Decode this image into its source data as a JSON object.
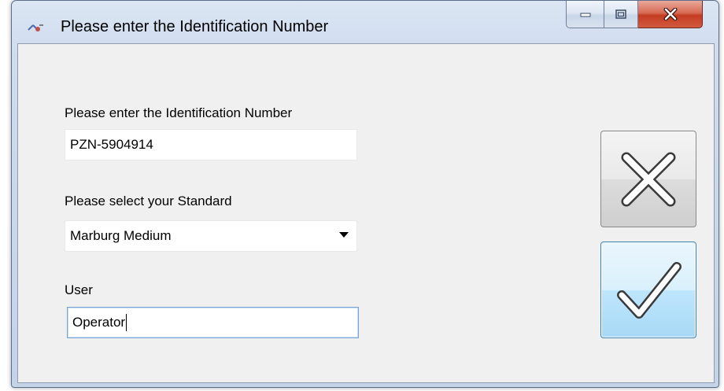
{
  "window": {
    "title": "Please enter the Identification Number",
    "icon": "app-icon",
    "controls": [
      "minimize-icon",
      "maximize-icon",
      "close-icon"
    ]
  },
  "form": {
    "id_label": "Please enter the Identification Number",
    "id_value": "PZN-5904914",
    "standard_label": "Please select your Standard",
    "standard_value": "Marburg Medium",
    "user_label": "User",
    "user_value": "Operator"
  },
  "buttons": {
    "cancel_icon": "cross-icon",
    "ok_icon": "checkmark-icon"
  },
  "colors": {
    "focus_border": "#7aa6d6",
    "ok_button_border": "#3c7fb1",
    "close_button": "#c43c22"
  }
}
